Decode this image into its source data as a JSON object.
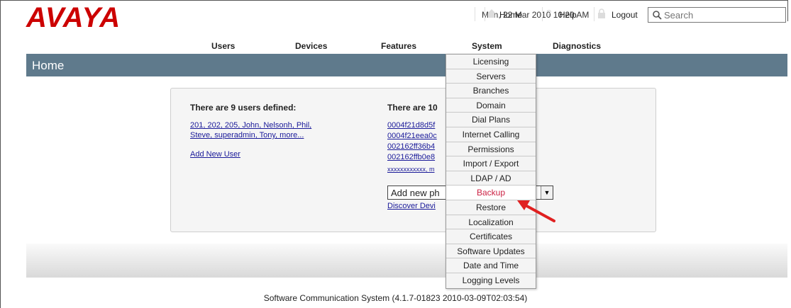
{
  "brand": {
    "logo_text": "AVAYA",
    "color": "#cc0000"
  },
  "header": {
    "datetime": "Mon, 22 Mar 2010 10:20 AM",
    "home_label": "Home",
    "help_label": "Help",
    "logout_label": "Logout",
    "search_placeholder": "Search"
  },
  "nav": {
    "items": [
      "Users",
      "Devices",
      "Features",
      "System",
      "Diagnostics"
    ]
  },
  "page": {
    "title": "Home",
    "bar_color": "#5f7a8c"
  },
  "users_section": {
    "heading": "There are 9 users defined:",
    "list_line1": "201, 202, 205, John, Nelsonh, Phil,",
    "list_line2": "Steve, superadmin, Tony, more...",
    "add_link": "Add New User"
  },
  "devices_section": {
    "heading": "There are 10",
    "devices": [
      "0004f21d8d5f",
      "0004f21eea0c",
      "002162ff36b4",
      "002162ffb0e8"
    ],
    "more": "xxxxxxxxxxxx, m",
    "select_value": "Add new ph",
    "discover_link": "Discover Devi"
  },
  "system_menu": {
    "items": [
      "Licensing",
      "Servers",
      "Branches",
      "Domain",
      "Dial Plans",
      "Internet Calling",
      "Permissions",
      "Import / Export",
      "LDAP / AD",
      "Backup",
      "Restore",
      "Localization",
      "Certificates",
      "Software Updates",
      "Date and Time",
      "Logging Levels"
    ],
    "active": "Backup",
    "active_color": "#cc2244"
  },
  "footer": {
    "text": "Software Communication System (4.1.7-01823 2010-03-09T02:03:54)"
  },
  "annotation": {
    "arrow_color": "#e02020"
  }
}
